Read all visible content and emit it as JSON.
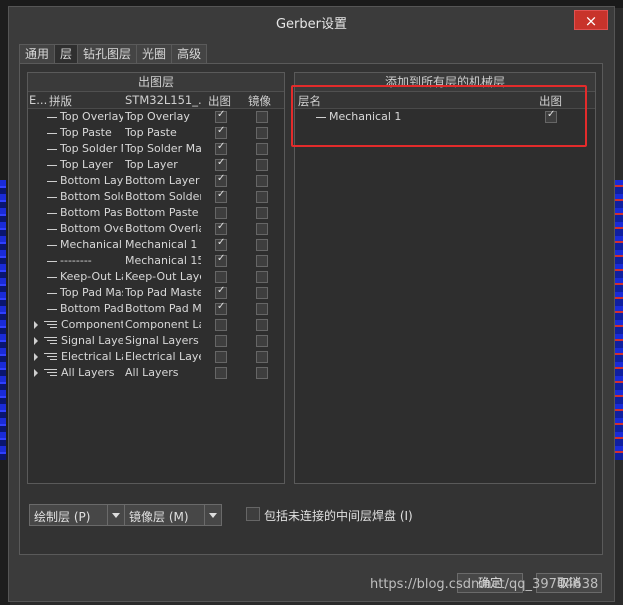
{
  "window": {
    "title": "Gerber设置",
    "close": "×"
  },
  "tabs": [
    "通用",
    "层",
    "钻孔图层",
    "光圈",
    "高级"
  ],
  "left_panel": {
    "header": "出图层",
    "columns": {
      "e": "E...",
      "name": "拼版",
      "layer": "STM32L151_...",
      "plot": "出图",
      "mirror": "镜像"
    },
    "rows": [
      {
        "name": "Top Overlay",
        "layer": "Top Overlay",
        "plot": true,
        "mirror": false,
        "group": false
      },
      {
        "name": "Top Paste",
        "layer": "Top Paste",
        "plot": true,
        "mirror": false,
        "group": false
      },
      {
        "name": "Top Solder Ma",
        "layer": "Top Solder Ma",
        "plot": true,
        "mirror": false,
        "group": false
      },
      {
        "name": "Top Layer",
        "layer": "Top Layer",
        "plot": true,
        "mirror": false,
        "group": false
      },
      {
        "name": "Bottom Layer",
        "layer": "Bottom Layer",
        "plot": true,
        "mirror": false,
        "group": false
      },
      {
        "name": "Bottom Solder",
        "layer": "Bottom Solder",
        "plot": true,
        "mirror": false,
        "group": false
      },
      {
        "name": "Bottom Paste",
        "layer": "Bottom Paste",
        "plot": false,
        "mirror": false,
        "group": false
      },
      {
        "name": "Bottom Overlay",
        "layer": "Bottom Overlay",
        "plot": true,
        "mirror": false,
        "group": false
      },
      {
        "name": "Mechanical",
        "layer": "Mechanical 1",
        "plot": true,
        "mirror": false,
        "group": false
      },
      {
        "name": "--------",
        "layer": "Mechanical 15",
        "plot": true,
        "mirror": false,
        "group": false
      },
      {
        "name": "Keep-Out Layer",
        "layer": "Keep-Out Layer",
        "plot": false,
        "mirror": false,
        "group": false
      },
      {
        "name": "Top Pad Master",
        "layer": "Top Pad Master",
        "plot": true,
        "mirror": false,
        "group": false
      },
      {
        "name": "Bottom Pad Master",
        "layer": "Bottom Pad Ma",
        "plot": true,
        "mirror": false,
        "group": false
      },
      {
        "name": "Component Layers",
        "layer": "Component Layers",
        "plot": false,
        "mirror": false,
        "group": true
      },
      {
        "name": "Signal Layers",
        "layer": "Signal Layers",
        "plot": false,
        "mirror": false,
        "group": true
      },
      {
        "name": "Electrical Layers",
        "layer": "Electrical Layers",
        "plot": false,
        "mirror": false,
        "group": true
      },
      {
        "name": "All Layers",
        "layer": "All Layers",
        "plot": false,
        "mirror": false,
        "group": true
      }
    ]
  },
  "right_panel": {
    "header": "添加到所有层的机械层",
    "columns": {
      "name": "层名",
      "plot": "出图"
    },
    "rows": [
      {
        "name": "Mechanical 1",
        "plot": true
      }
    ]
  },
  "bottom": {
    "plot_layers_btn": "绘制层 (P)",
    "mirror_layers_btn": "镜像层 (M)",
    "include_unconnected": "包括未连接的中间层焊盘 (I)",
    "include_unconnected_checked": false
  },
  "footer": {
    "ok": "确定",
    "cancel": "取消"
  },
  "watermark": "https://blog.csdn.net/qq_39704638",
  "colors": {
    "highlight_box": "#e32b2b",
    "close_button": "#c8332b"
  }
}
